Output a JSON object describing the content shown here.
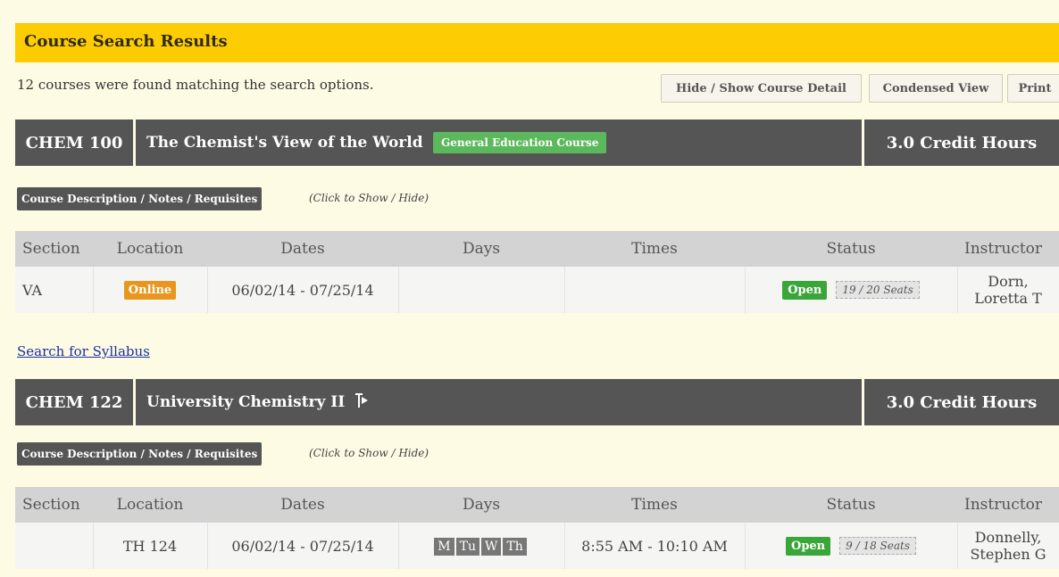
{
  "header": {
    "title": "Course Search Results"
  },
  "results": {
    "summary": "12 courses were found matching the search options.",
    "buttons": {
      "detail": "Hide / Show Course Detail",
      "condensed": "Condensed View",
      "print": "Print"
    }
  },
  "columns": [
    "Section",
    "Location",
    "Dates",
    "Days",
    "Times",
    "Status",
    "Instructor"
  ],
  "courses": [
    {
      "code": "CHEM 100",
      "name": "The Chemist's View of the World",
      "badge": "General Education Course",
      "credits": "3.0 Credit Hours",
      "desc_button": "Course Description / Notes / Requisites",
      "desc_hint": "(Click to Show / Hide)",
      "section": {
        "section": "VA",
        "location": "Online",
        "dates": "06/02/14 - 07/25/14",
        "days": [],
        "times": "",
        "status": "Open",
        "seats": "19 / 20 Seats",
        "instructor_line1": "Dorn,",
        "instructor_line2": "Loretta T"
      },
      "syllabus_link": "Search for Syllabus"
    },
    {
      "code": "CHEM 122",
      "name": "University Chemistry II",
      "icon": "flag-icon",
      "credits": "3.0 Credit Hours",
      "desc_button": "Course Description / Notes / Requisites",
      "desc_hint": "(Click to Show / Hide)",
      "section": {
        "section": "",
        "location": "TH 124",
        "dates": "06/02/14 - 07/25/14",
        "days": [
          "M",
          "Tu",
          "W",
          "Th"
        ],
        "times": "8:55 AM - 10:10 AM",
        "status": "Open",
        "seats": "9 / 18 Seats",
        "instructor_line1": "Donnelly,",
        "instructor_line2": "Stephen G"
      }
    }
  ],
  "colors": {
    "header_bg": "#fdcc02",
    "course_header_bg": "#555555",
    "gen_ed_badge": "#5cb85c",
    "online_badge": "#e8961e",
    "open_badge": "#3aa63a",
    "page_bg": "#fdfbe3"
  }
}
